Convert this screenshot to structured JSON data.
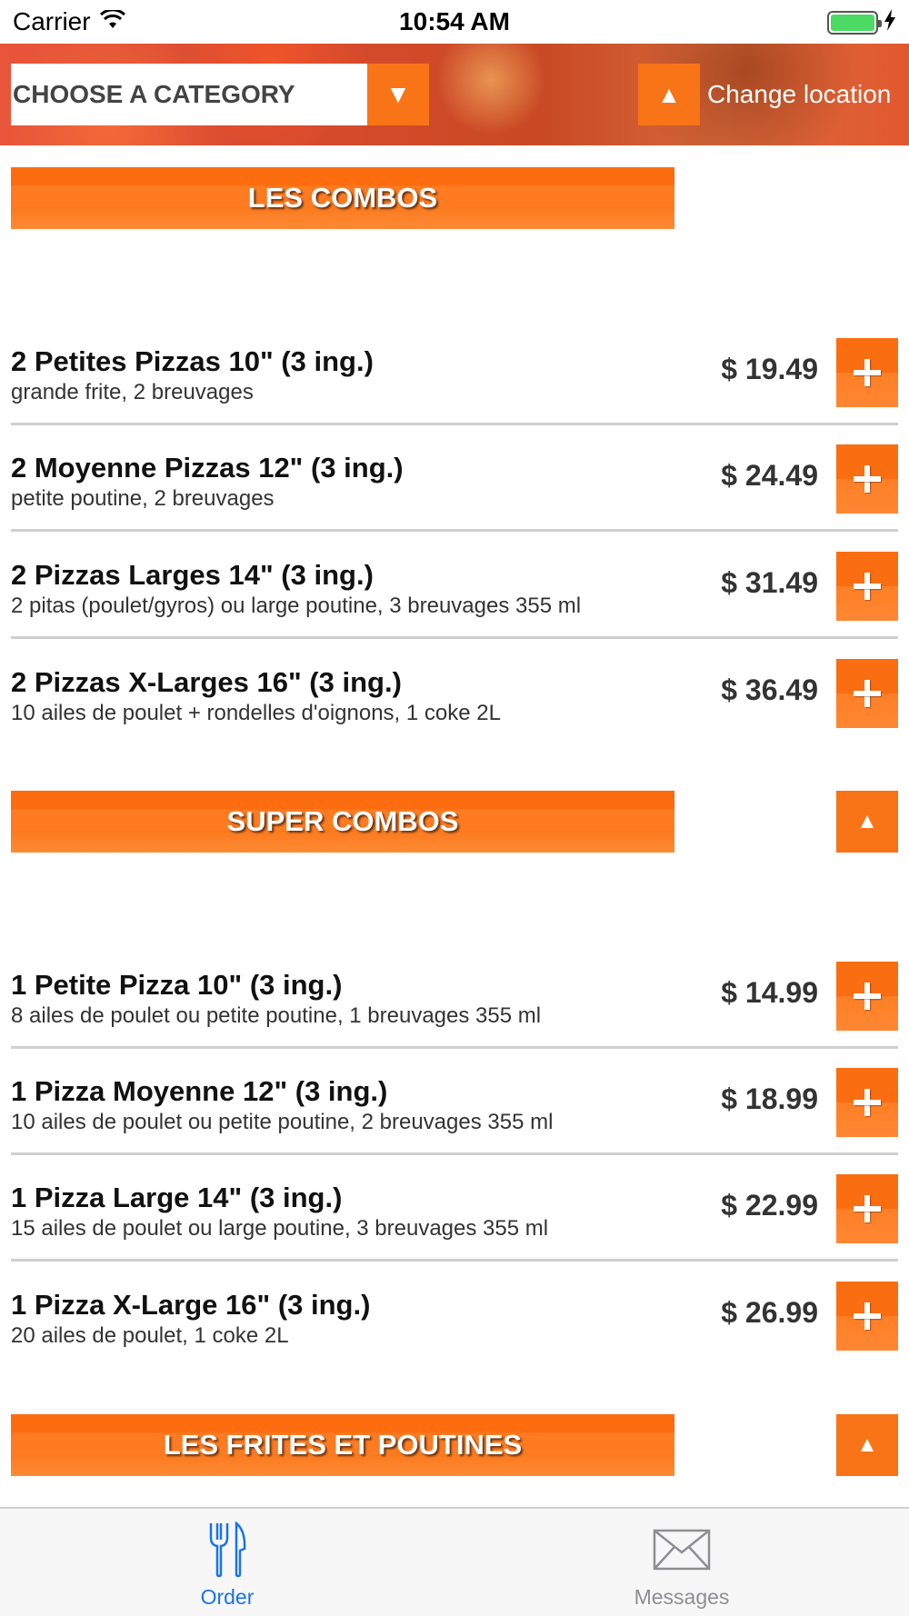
{
  "status_bar": {
    "carrier": "Carrier",
    "time": "10:54 AM",
    "wifi_icon": "wifi-icon",
    "battery_icon": "battery-icon",
    "charging_icon": "bolt-icon"
  },
  "header": {
    "category_label": "CHOOSE A CATEGORY",
    "dropdown_icon": "▼",
    "location_up_icon": "▲",
    "location_label": "Change location"
  },
  "sections": [
    {
      "title": "LES COMBOS",
      "items": [
        {
          "name": "2 Petites Pizzas 10\" (3 ing.)",
          "desc": "grande frite, 2 breuvages",
          "price": "$ 19.49"
        },
        {
          "name": "2 Moyenne Pizzas 12\" (3 ing.)",
          "desc": "petite poutine, 2 breuvages",
          "price": "$ 24.49"
        },
        {
          "name": "2 Pizzas Larges 14\" (3 ing.)",
          "desc": "2 pitas (poulet/gyros) ou large poutine, 3 breuvages 355 ml",
          "price": "$ 31.49"
        },
        {
          "name": "2 Pizzas X-Larges 16\" (3 ing.)",
          "desc": "10 ailes de poulet + rondelles d'oignons, 1 coke 2L",
          "price": "$ 36.49"
        }
      ]
    },
    {
      "title": "SUPER COMBOS",
      "collapse_icon": "▲",
      "items": [
        {
          "name": "1 Petite Pizza 10\" (3 ing.)",
          "desc": "8 ailes de poulet ou petite poutine, 1 breuvages 355 ml",
          "price": "$ 14.99"
        },
        {
          "name": "1 Pizza Moyenne 12\" (3 ing.)",
          "desc": "10 ailes de poulet ou petite poutine, 2 breuvages 355 ml",
          "price": "$ 18.99"
        },
        {
          "name": "1 Pizza Large 14\" (3 ing.)",
          "desc": "15 ailes de poulet ou large poutine, 3 breuvages 355 ml",
          "price": "$ 22.99"
        },
        {
          "name": "1 Pizza X-Large 16\" (3 ing.)",
          "desc": "20 ailes de poulet, 1 coke 2L",
          "price": "$ 26.99"
        }
      ]
    },
    {
      "title": "LES FRITES ET POUTINES",
      "collapse_icon": "▲"
    }
  ],
  "tab_bar": {
    "tabs": [
      {
        "label": "Order",
        "icon": "fork-knife-icon",
        "active": true
      },
      {
        "label": "Messages",
        "icon": "envelope-icon",
        "active": false
      }
    ]
  },
  "colors": {
    "accent_orange": "#f97317",
    "tab_active_blue": "#1a73e8",
    "tab_inactive_gray": "#8e8e93"
  }
}
